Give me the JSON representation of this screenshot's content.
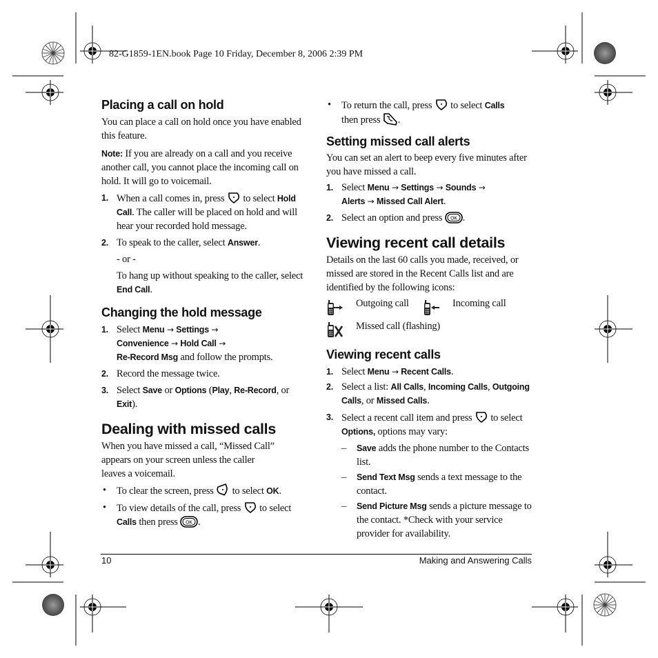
{
  "header": {
    "print_slug": "82-G1859-1EN.book  Page 10  Friday, December 8, 2006  2:39 PM"
  },
  "left": {
    "hold": {
      "title": "Placing a call on hold",
      "intro": "You can place a call on hold once you have enabled this feature.",
      "note_label": "Note:",
      "note_text": " If you are already on a call and you receive another call, you cannot place the incoming call on hold. It will go to voicemail.",
      "steps": [
        {
          "num": "1.",
          "a": "When a call comes in, press ",
          "b": " to select ",
          "bold": "Hold Call",
          "c": ". The caller will be placed on hold and will hear your recorded hold message."
        },
        {
          "num": "2.",
          "a": "To speak to the caller, select ",
          "bold": "Answer",
          "c": "."
        }
      ],
      "or": "- or -",
      "alt_a": "To hang up without speaking to the caller, select ",
      "alt_bold": "End Call",
      "alt_c": "."
    },
    "change": {
      "title": "Changing the hold message",
      "step1_num": "1.",
      "step1_a": "Select ",
      "path": [
        "Menu",
        "Settings",
        "Convenience",
        "Hold Call",
        "Re-Record Msg"
      ],
      "arrow": "→",
      "step1_c": " and follow the prompts.",
      "step2_num": "2.",
      "step2": "Record the message twice.",
      "step3_num": "3.",
      "step3_a": "Select ",
      "save": "Save",
      "or_word": " or ",
      "options": "Options",
      "paren_open": " (",
      "play": "Play",
      "comma": ", ",
      "rerecord": "Re-Record",
      "comma_or": ", or ",
      "exit": "Exit",
      "paren_close": ")."
    },
    "missed": {
      "title": "Dealing with missed calls",
      "intro_1": "When you have missed a call, “Missed Call”",
      "intro_2": "appears on your screen unless the caller",
      "intro_3": "leaves a voicemail.",
      "bullets": [
        {
          "a": "To clear the screen, press ",
          "b": " to select ",
          "bold": "OK",
          "c": "."
        },
        {
          "a": "To view details of the call, press ",
          "b": " to select ",
          "bold": "Calls",
          "c": " then press ",
          "d": "."
        }
      ]
    }
  },
  "right": {
    "return_bullet": {
      "a": "To return the call, press ",
      "b": " to select ",
      "bold": "Calls",
      "c": " then press ",
      "d": "."
    },
    "alerts": {
      "title": "Setting missed call alerts",
      "intro": "You can set an alert to beep every five minutes after you have missed a call.",
      "step1_num": "1.",
      "step1_a": "Select ",
      "path": [
        "Menu",
        "Settings",
        "Sounds",
        "Alerts",
        "Missed Call Alert"
      ],
      "step1_end": ".",
      "step2_num": "2.",
      "step2_a": "Select an option and press ",
      "step2_end": "."
    },
    "details": {
      "title": "Viewing recent call details",
      "intro": "Details on the last 60 calls you made, received, or missed are stored in the Recent Calls list and are identified by the following icons:",
      "icons": [
        {
          "icon": "outgoing-call-icon",
          "label": "Outgoing call"
        },
        {
          "icon": "incoming-call-icon",
          "label": "Incoming call"
        },
        {
          "icon": "missed-call-icon",
          "label": "Missed call (flashing)"
        }
      ]
    },
    "recent": {
      "title": "Viewing recent calls",
      "step1_num": "1.",
      "step1_a": "Select ",
      "step1_menu": "Menu",
      "step1_target": "Recent Calls",
      "step1_end": ".",
      "step2_num": "2.",
      "step2_a": "Select a list: ",
      "lists": [
        "All Calls",
        "Incoming Calls",
        "Outgoing Calls",
        "Missed Calls"
      ],
      "step2_sep1": ", ",
      "step2_sep2": ", ",
      "step2_sep3": ", or ",
      "step2_end": ".",
      "step3_num": "3.",
      "step3_a": "Select a recent call item and press ",
      "step3_b": " to select ",
      "step3_bold": "Options,",
      "step3_c": " options may vary:",
      "options": [
        {
          "dash": "–",
          "bold": "Save",
          "text": " adds the phone number to the Contacts list."
        },
        {
          "dash": "–",
          "bold": "Send Text Msg",
          "text": " sends a text message to the contact."
        },
        {
          "dash": "–",
          "bold": "Send Picture Msg",
          "text": " sends a picture message to the contact. *Check with your service provider for availability."
        }
      ]
    }
  },
  "footer": {
    "page_number": "10",
    "section": "Making and Answering Calls"
  }
}
